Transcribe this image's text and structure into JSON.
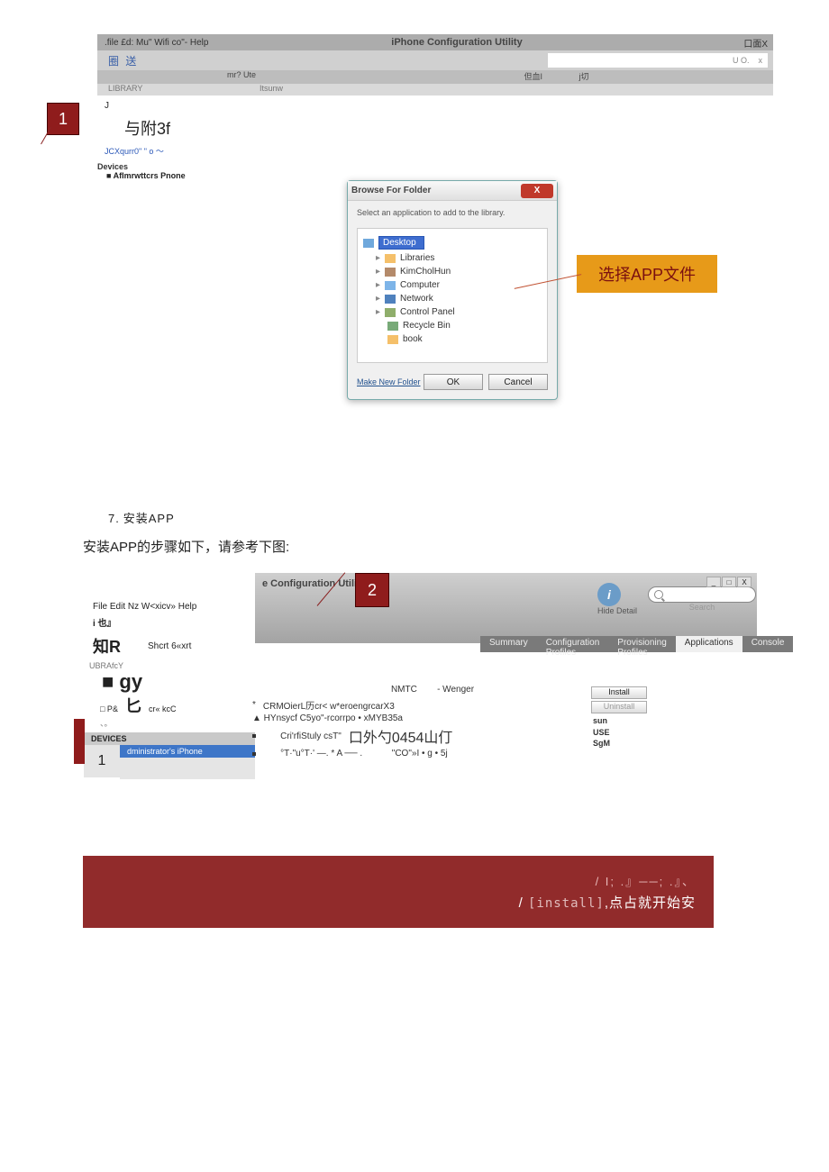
{
  "shot1": {
    "titlebar": {
      "left": ".file £d: Mu\" Wifi co\"- Help",
      "center": "iPhone Configuration Utility",
      "right": "口面X"
    },
    "row2": {
      "left": "圈 送",
      "right_small": "U O.",
      "right_x": "x"
    },
    "row3": {
      "left": "mr? Ute",
      "r1": "但血I",
      "r2": "j切"
    },
    "row4": {
      "a": "LIBRARY",
      "b": "Itsunw"
    },
    "side": {
      "l1": "J",
      "big": "与附3f",
      "blue": "JCXqurr0\" \" o   〜",
      "devices": "Devices",
      "device_item": "■ AfImrwttcrs Pnone"
    }
  },
  "callout1": "1",
  "dialog": {
    "title": "Browse For Folder",
    "inst": "Select an application to add to the library.",
    "items": [
      "Desktop",
      "Libraries",
      "KimCholHun",
      "Computer",
      "Network",
      "Control Panel",
      "Recycle Bin",
      "book"
    ],
    "make": "Make New Folder",
    "ok": "OK",
    "cancel": "Cancel"
  },
  "orange": "选择APP文件",
  "step7_num": "7.",
  "step7_text": "安装APP",
  "step_desc": "安装APP的步骤如下，请参考下图:",
  "shot2": {
    "menus": "File Edit Nz W<xicv» Help",
    "row1": "i 也』",
    "row2a": "知R",
    "row2b": "Shcrt 6«xrt",
    "row3": "UBRAfcY",
    "row4": "■ gy",
    "row5a": "□ P&",
    "row5b": "匕",
    "row5c": "cr« kcC",
    "row6": "、。",
    "sec": "DEVICES",
    "selected": "dministrator's iPhone",
    "one": "1",
    "title_partial": "e Configuration Utility",
    "hide": "Hide Detail",
    "search": "Search",
    "tabs": [
      "Summary",
      "Configuration Profiles",
      "Provisioning Profiles",
      "Applications",
      "Console"
    ],
    "detail_hd1": "NMTC",
    "detail_hd2": "- Wenger",
    "d1": "CRMOierL历cr<   w*eroengrcarX3",
    "d2": "▲ HYnsycf C5yo\"-rcorrpo • xMYB35a",
    "d3a": "Cri'rfiStuly csT\"",
    "d3b": "口外勺0454山仃",
    "d4a": "°T·\"u°T·' ―. * A ── .",
    "d4b": "\"CO\"»I • g • 5j"
  },
  "install_panel": {
    "btn1": "Install",
    "btn2": "Uninstall",
    "list": [
      "sun",
      "USE",
      "SgM"
    ]
  },
  "callout2": "2",
  "banner": {
    "l1": "/       I; .』──; .』、",
    "l2_pre": "/        ",
    "l2_code": "[install]",
    "l2_post": ",点占就开始安"
  }
}
